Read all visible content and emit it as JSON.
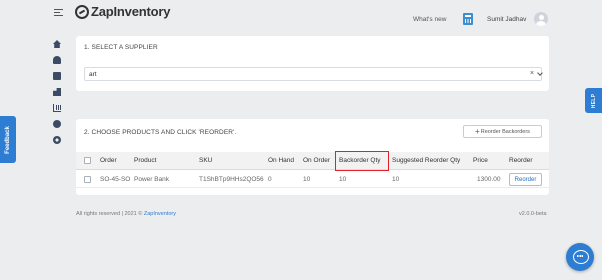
{
  "header": {
    "app_name": "ZapInventory",
    "whats_new": "What's new",
    "user_name": "Sumit Jadhav"
  },
  "sidebar": {
    "icons": [
      "home-icon",
      "users-icon",
      "box-icon",
      "boxes-icon",
      "chart-icon",
      "circle-icon",
      "gear-icon"
    ]
  },
  "feedback_label": "Feedback",
  "help_label": "HELP",
  "supplier_section": {
    "title": "1. SELECT A SUPPLIER",
    "selected_value": "art",
    "clear_symbol": "×"
  },
  "products_section": {
    "title": "2. CHOOSE PRODUCTS AND CLICK 'REORDER'.",
    "reorder_backorders_label": "Reorder Backorders",
    "columns": [
      "Order",
      "Product",
      "SKU",
      "On Hand",
      "On Order",
      "Backorder Qty",
      "Suggested Reorder Qty",
      "Price",
      "Reorder"
    ],
    "rows": [
      {
        "order": "SO-45-SO",
        "product": "Power Bank",
        "sku": "T1ShBTp9HHs2QO56",
        "on_hand": "0",
        "on_order": "10",
        "backorder_qty": "10",
        "suggested_reorder_qty": "10",
        "price": "1300.00",
        "reorder_label": "Reorder"
      }
    ],
    "highlighted_column": "Backorder Qty"
  },
  "footer": {
    "rights_prefix": "All rights reserved | 2021 ©",
    "brand": "ZapInventory",
    "version": "v2.0.0-beta"
  },
  "colors": {
    "accent": "#2d7dd2",
    "highlight": "#e3202a",
    "background": "#ebedef"
  }
}
